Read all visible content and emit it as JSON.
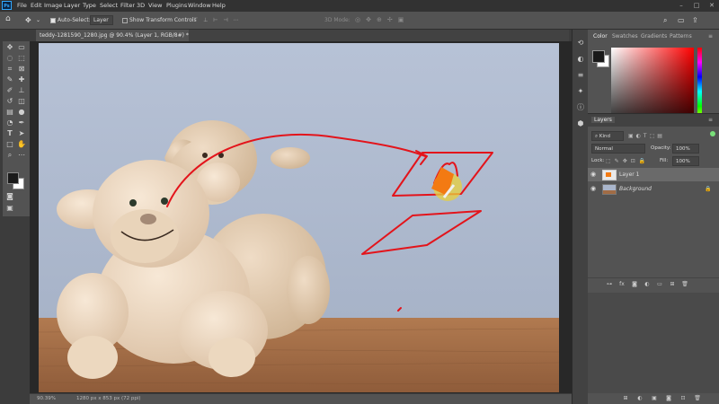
{
  "menu": {
    "logo": "Ps",
    "items": [
      "File",
      "Edit",
      "Image",
      "Layer",
      "Type",
      "Select",
      "Filter",
      "3D",
      "View",
      "Plugins",
      "Window",
      "Help"
    ]
  },
  "options_bar": {
    "auto_select_label": "Auto-Select:",
    "auto_select_value": "Layer",
    "show_transform_label": "Show Transform Controls",
    "mode_label": "3D Mode:"
  },
  "document_tab": {
    "title": "teddy-1281590_1280.jpg @ 90.4% (Layer 1, RGB/8#) *"
  },
  "status_bar": {
    "zoom": "90.39%",
    "doc_info": "1280 px x 853 px (72 ppi)"
  },
  "color_panel": {
    "tabs": [
      "Color",
      "Swatches",
      "Gradients",
      "Patterns"
    ],
    "foreground": "#1a1a1a",
    "background": "#ffffff"
  },
  "layers_panel": {
    "title": "Layers",
    "filter_label": "Kind",
    "blend_mode": "Normal",
    "opacity_label": "Opacity:",
    "opacity_value": "100%",
    "lock_label": "Lock:",
    "fill_label": "Fill:",
    "fill_value": "100%",
    "layers": [
      {
        "name": "Layer 1",
        "visible": true,
        "selected": true
      },
      {
        "name": "Background",
        "visible": true,
        "selected": false,
        "locked": true
      }
    ]
  }
}
